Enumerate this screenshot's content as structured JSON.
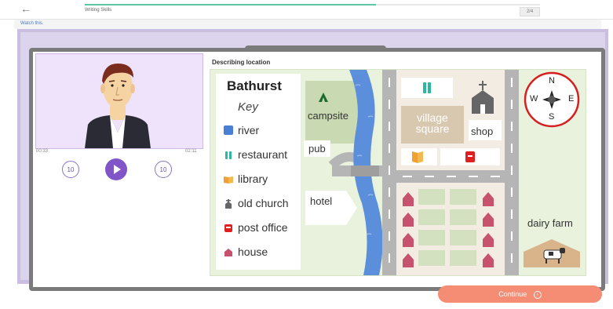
{
  "header": {
    "back_icon": "arrow-left-icon",
    "lesson_title": "Writing Skills",
    "progress": 0.64,
    "page_count": "2/4"
  },
  "watch": {
    "label": "Watch this."
  },
  "video": {
    "time_current": "00:33",
    "time_total": "02:11",
    "rewind_label": "10",
    "forward_label": "10"
  },
  "content": {
    "heading": "Describing location",
    "map_title": "Bathurst",
    "key_title": "Key",
    "key_items": [
      {
        "label": "river",
        "icon": "river-icon",
        "color": "#4a7fd6"
      },
      {
        "label": "restaurant",
        "icon": "restaurant-icon",
        "color": "#2bb8a3"
      },
      {
        "label": "library",
        "icon": "library-icon",
        "color": "#f0a030"
      },
      {
        "label": "old church",
        "icon": "church-icon",
        "color": "#666666"
      },
      {
        "label": "post office",
        "icon": "post-office-icon",
        "color": "#e02020"
      },
      {
        "label": "house",
        "icon": "house-icon",
        "color": "#c7526e"
      }
    ],
    "map_labels": {
      "campsite": "campsite",
      "pub": "pub",
      "hotel": "hotel",
      "village_square": "village\nsquare",
      "shop": "shop",
      "dairy_farm": "dairy farm"
    },
    "compass": {
      "n": "N",
      "s": "S",
      "e": "E",
      "w": "W"
    }
  },
  "footer": {
    "continue_label": "Continue",
    "continue_icon": "arrow-circle-right-icon"
  },
  "colors": {
    "accent": "#7f55c7",
    "continue": "#f58d74",
    "progress": "#5cc7a8",
    "road": "#b5b5b5",
    "water": "#5c8fdb",
    "house": "#c7526e"
  }
}
